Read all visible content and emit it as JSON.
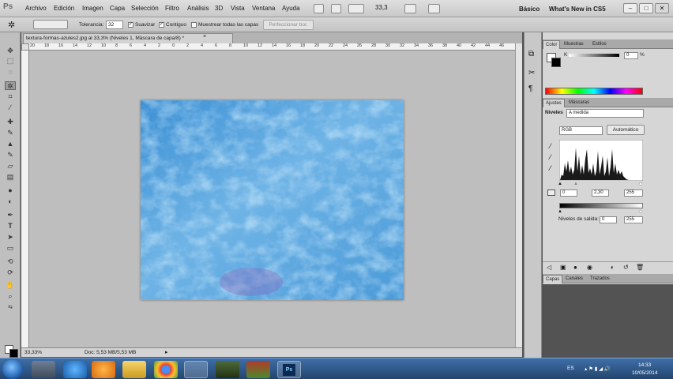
{
  "app": {
    "logo": "Ps"
  },
  "menu": [
    "Archivo",
    "Edición",
    "Imagen",
    "Capa",
    "Selección",
    "Filtro",
    "Análisis",
    "3D",
    "Vista",
    "Ventana",
    "Ayuda"
  ],
  "menubar": {
    "zoom": "33,3",
    "workspace": "Básico",
    "whats_new": "What's New in CS5"
  },
  "options": {
    "tolerance_label": "Tolerancia:",
    "tolerance_value": "32",
    "antialias_label": "Suavizar",
    "contiguous_label": "Contiguo",
    "sample_all_label": "Muestrear todas las capas",
    "refine_edge_label": "Perfeccionar bor."
  },
  "document": {
    "tab_title": "textura-formas-azules2.jpg al 33,3% (Niveles 1, Máscara de capa/8) *",
    "ruler_ticks": [
      "20",
      "18",
      "16",
      "14",
      "12",
      "10",
      "8",
      "6",
      "4",
      "2",
      "0",
      "2",
      "4",
      "6",
      "8",
      "10",
      "12",
      "14",
      "16",
      "18",
      "20",
      "22",
      "24",
      "26",
      "28",
      "30",
      "32",
      "34",
      "36",
      "38",
      "40",
      "42",
      "44",
      "46"
    ],
    "zoom_status": "33,33%",
    "doc_status": "Doc: 5,53 MB/5,53 MB"
  },
  "color_panel": {
    "tabs": [
      "Color",
      "Muestras",
      "Estilos"
    ],
    "channel_label": "K",
    "value": "0",
    "unit": "%"
  },
  "adjustments_panel": {
    "tabs": [
      "Ajustes",
      "Máscaras"
    ],
    "title": "Niveles",
    "preset": "A medida",
    "channel": "RGB",
    "auto_label": "Automático",
    "input_black": "0",
    "input_gamma": "2,30",
    "input_white": "255",
    "output_label": "Niveles de salida:",
    "output_black": "0",
    "output_white": "255"
  },
  "layers_panel": {
    "tabs": [
      "Capas",
      "Canales",
      "Trazados"
    ]
  },
  "taskbar": {
    "language": "ES",
    "time": "14:33",
    "date": "10/05/2014"
  },
  "colors": {
    "accent": "#2c6fb8",
    "image_mid": "#4e9ed8"
  }
}
